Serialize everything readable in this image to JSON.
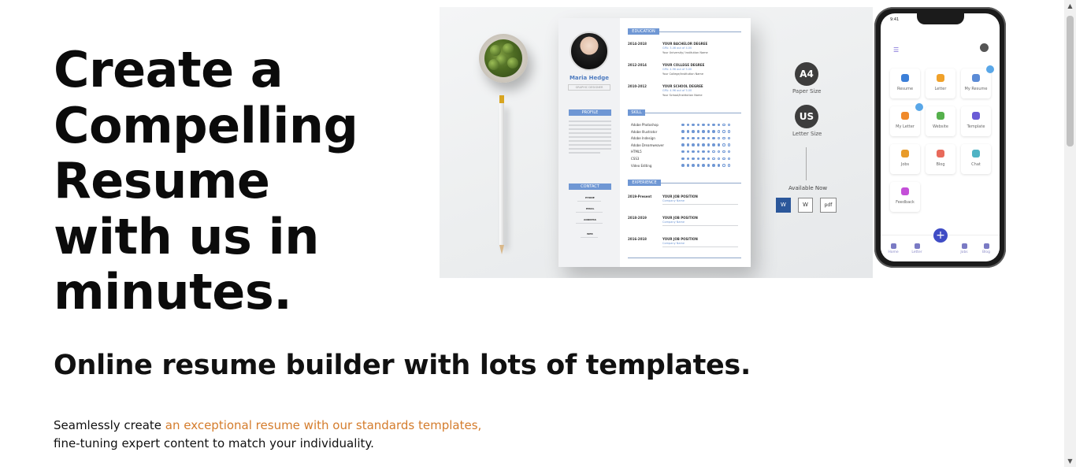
{
  "hero": {
    "title_lines": [
      "Create a",
      "Compelling",
      "Resume",
      "with us in",
      "minutes."
    ],
    "subtitle": "Online resume builder with lots of templates.",
    "description_part1": "Seamlessly create ",
    "description_accent": "an exceptional resume with our standards templates,",
    "description_part2": "fine-tuning expert content to match your individuality.",
    "accent_color": "#d47c2c"
  },
  "showcase": {
    "resume": {
      "name": "Maria Hedge",
      "role": "GRAPHIC DESIGNER",
      "sections": {
        "education": "EDUCATION",
        "profile": "PROFILE",
        "skill": "SKILL",
        "contact": "CONTACT",
        "experience": "EXPERIENCE"
      },
      "education": [
        {
          "years": "2014-2018",
          "degree": "YOUR BACHELOR DEGREE",
          "gpa": "GPA: 3.46 out of 4.00",
          "school": "Your University/ Institution Name"
        },
        {
          "years": "2012-2014",
          "degree": "YOUR COLLEGE DEGREE",
          "gpa": "GPA: 4.96 out of 5.00",
          "school": "Your College/Institution Name"
        },
        {
          "years": "2010-2012",
          "degree": "YOUR SCHOOL DEGREE",
          "gpa": "GPA: 4.96 out of 5.00",
          "school": "Your School/Institution Name"
        }
      ],
      "skills": [
        "Adobe Photoshop",
        "Adobe Illustrator",
        "Adobe Indesign",
        "Adobe Dreamweaver",
        "HTML5",
        "CSS3",
        "Video Editing"
      ],
      "contact_labels": [
        "PHONE",
        "EMAIL",
        "ADDRESS",
        "WEB"
      ],
      "experience": [
        {
          "years": "2019-Present",
          "title": "YOUR JOB POSITION",
          "company": "Company Name"
        },
        {
          "years": "2018-2019",
          "title": "YOUR JOB POSITION",
          "company": "Company Name"
        },
        {
          "years": "2016-2018",
          "title": "YOUR JOB POSITION",
          "company": "Company Name"
        }
      ]
    },
    "paper_sizes": [
      {
        "badge": "A4",
        "label": "Paper Size"
      },
      {
        "badge": "US",
        "label": "Letter Size"
      }
    ],
    "available_now": "Available Now",
    "formats": [
      "W",
      "W",
      "pdf"
    ]
  },
  "phone": {
    "time": "9:41",
    "tiles": [
      {
        "label": "Resume",
        "color": "#3b7fd8"
      },
      {
        "label": "Letter",
        "color": "#f0a12a"
      },
      {
        "label": "My Resume",
        "color": "#5b8bd6"
      },
      {
        "label": "My Letter",
        "color": "#f08a2a"
      },
      {
        "label": "Website",
        "color": "#55b04c"
      },
      {
        "label": "Template",
        "color": "#6a5bd6"
      },
      {
        "label": "Jobs",
        "color": "#e89b2a"
      },
      {
        "label": "Blog",
        "color": "#e86a5b"
      },
      {
        "label": "Chat",
        "color": "#4fb3c4"
      },
      {
        "label": "Feedback",
        "color": "#c44fd8"
      }
    ],
    "nav": [
      "Home",
      "Letter",
      "Jobs",
      "Blog"
    ]
  }
}
